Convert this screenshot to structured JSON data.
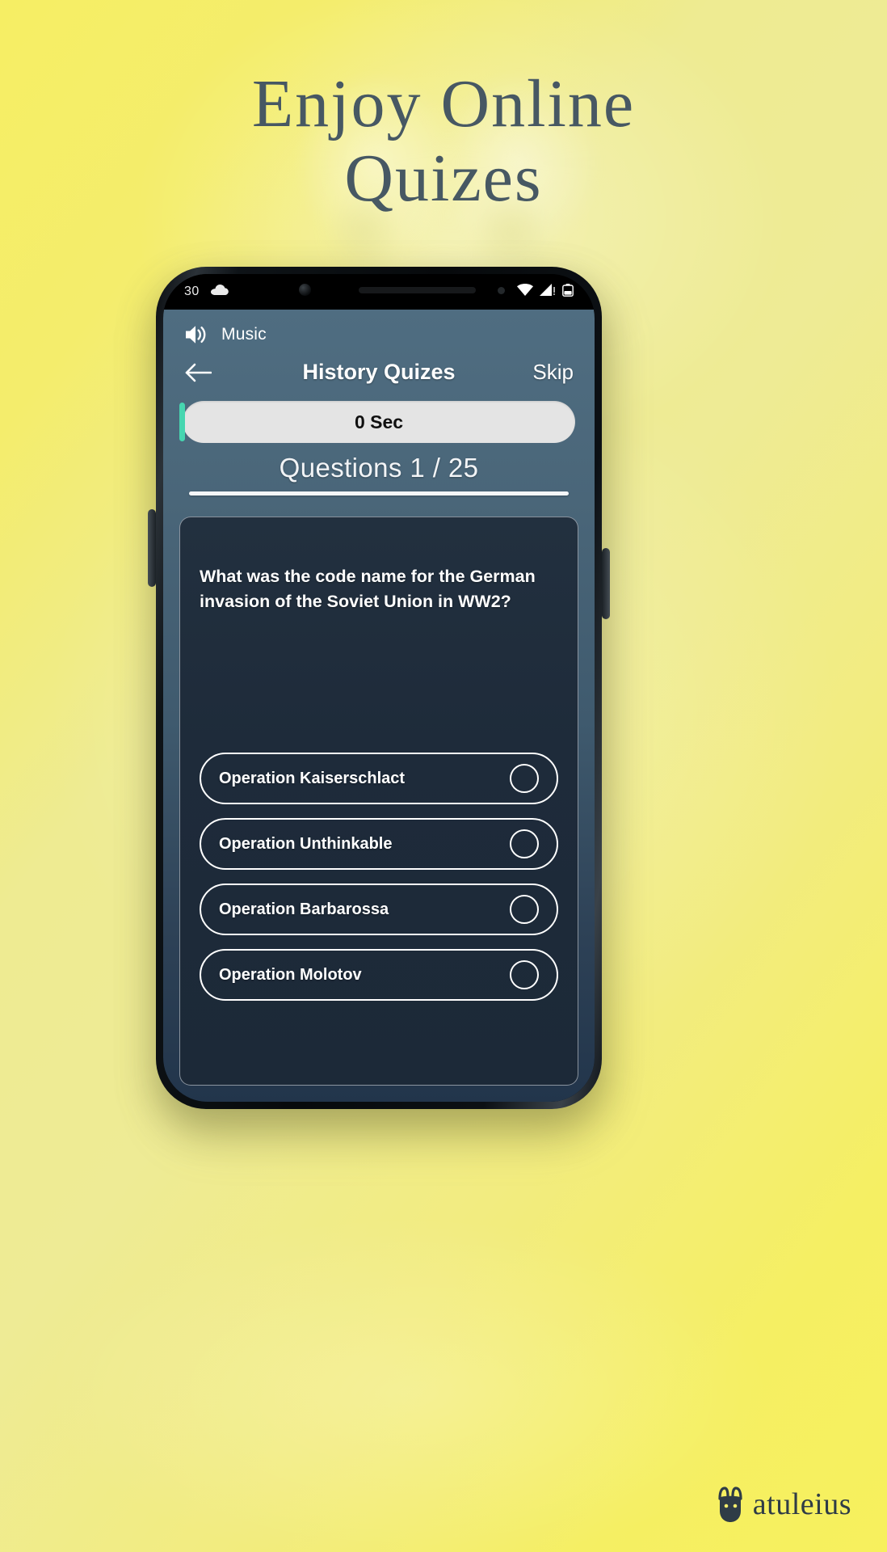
{
  "headline": {
    "line1": "Enjoy Online",
    "line2": "Quizes"
  },
  "statusbar": {
    "time": "30",
    "weather_icon": "cloud-icon",
    "wifi_icon": "wifi-icon",
    "signal_icon": "cellular-signal-icon",
    "battery_icon": "battery-icon"
  },
  "app": {
    "music": {
      "icon": "speaker-volume-icon",
      "label": "Music"
    },
    "appbar": {
      "back_icon": "back-arrow-icon",
      "title": "History Quizes",
      "skip_label": "Skip"
    },
    "timer": {
      "text": "0 Sec",
      "fill_color": "#46d6b0",
      "track_color": "#e4e4e4"
    },
    "question_counter": "Questions 1 / 25",
    "question": {
      "text": "What was the code name for the German invasion of the Soviet Union in WW2?"
    },
    "options": [
      {
        "label": "Operation Kaiserschlact",
        "selected": false
      },
      {
        "label": "Operation Unthinkable",
        "selected": false
      },
      {
        "label": "Operation Barbarossa",
        "selected": false
      },
      {
        "label": "Operation Molotov",
        "selected": false
      }
    ]
  },
  "brand": {
    "name": "atuleius",
    "mark": "cat-head-icon"
  },
  "colors": {
    "background_yellow": "#f4ed6c",
    "headline_text": "#475863",
    "app_header": "#4f6d81",
    "card_background": "#1e2b3a",
    "accent_teal": "#46d6b0"
  }
}
